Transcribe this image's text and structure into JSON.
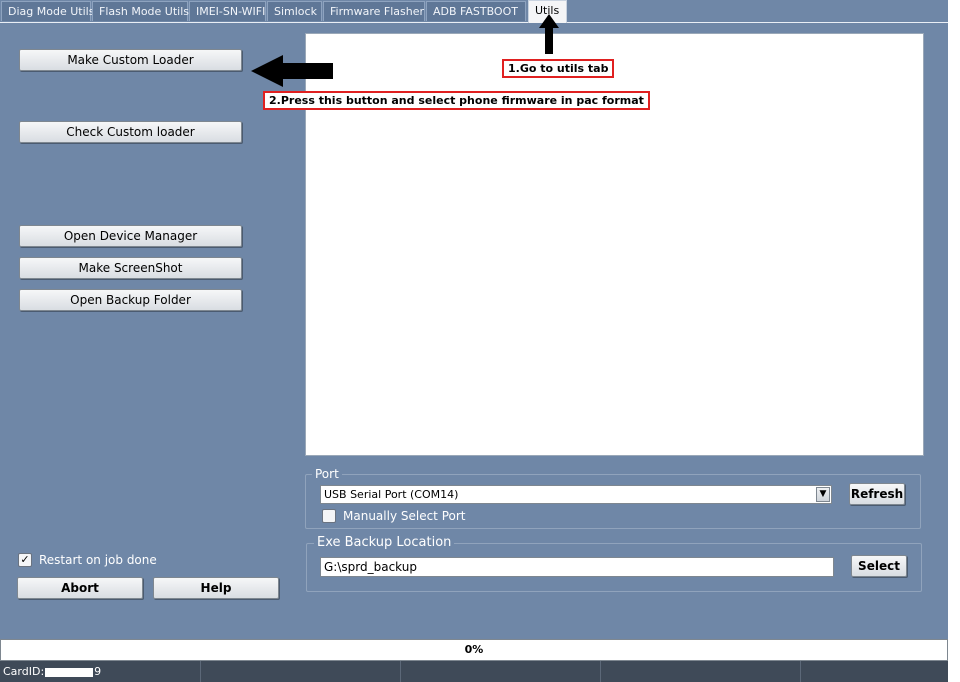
{
  "tabs": [
    {
      "label": "Diag Mode Utils"
    },
    {
      "label": "Flash Mode Utils"
    },
    {
      "label": "IMEI-SN-WIFI"
    },
    {
      "label": "Simlock"
    },
    {
      "label": "Firmware Flasher"
    },
    {
      "label": "ADB FASTBOOT"
    },
    {
      "label": "Utils"
    }
  ],
  "active_tab": "Utils",
  "left_buttons": {
    "make_custom_loader": "Make Custom Loader",
    "check_custom_loader": "Check Custom loader",
    "open_device_manager": "Open Device Manager",
    "make_screenshot": "Make ScreenShot",
    "open_backup_folder": "Open Backup Folder"
  },
  "options": {
    "restart_on_job_done": "Restart on job done",
    "restart_checked": true
  },
  "actions": {
    "abort": "Abort",
    "help": "Help"
  },
  "port": {
    "title": "Port",
    "selected": "USB Serial Port (COM14)",
    "refresh": "Refresh",
    "manual_select": "Manually Select Port",
    "manual_checked": false
  },
  "backup": {
    "title": "Exe Backup Location",
    "path": "G:\\sprd_backup",
    "select": "Select"
  },
  "annotations": {
    "step1": "1.Go to utils tab",
    "step2": "2.Press this button and select phone firmware in pac format"
  },
  "progress": {
    "text": "0%",
    "value": 0
  },
  "status": {
    "card_prefix": "CardID:",
    "card_suffix": "9"
  },
  "colors": {
    "background": "#6f87a7",
    "annotation_border": "#e02020"
  }
}
